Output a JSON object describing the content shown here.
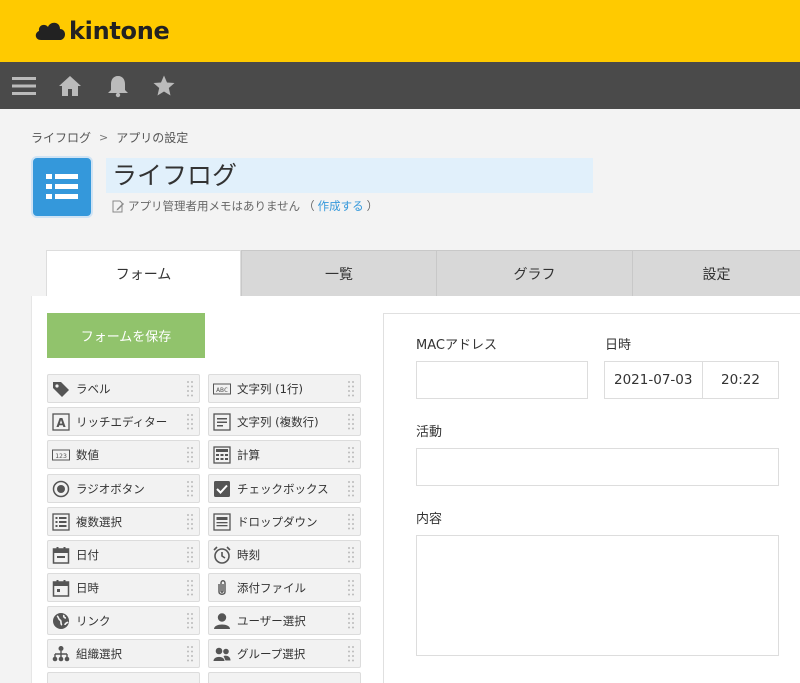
{
  "header": {
    "logo_text": "kintone",
    "brand_color": "#ffca00"
  },
  "nav": {
    "icons": [
      "menu-icon",
      "home-icon",
      "bell-icon",
      "star-icon"
    ]
  },
  "breadcrumb": {
    "app": "ライフログ",
    "separator": ">",
    "current": "アプリの設定"
  },
  "app": {
    "name": "ライフログ",
    "memo_text": "アプリ管理者用メモはありません",
    "memo_open": "（",
    "memo_link": "作成する",
    "memo_close": "）"
  },
  "tabs": [
    {
      "label": "フォーム",
      "active": true
    },
    {
      "label": "一覧",
      "active": false
    },
    {
      "label": "グラフ",
      "active": false
    },
    {
      "label": "設定",
      "active": false
    }
  ],
  "save_button": {
    "label": "フォームを保存",
    "color": "#91c36c"
  },
  "parts": [
    {
      "label": "ラベル",
      "icon": "tag-icon"
    },
    {
      "label": "文字列 (1行)",
      "icon": "abc-icon"
    },
    {
      "label": "リッチエディター",
      "icon": "rich-editor-icon"
    },
    {
      "label": "文字列 (複数行)",
      "icon": "multiline-text-icon"
    },
    {
      "label": "数値",
      "icon": "number-icon"
    },
    {
      "label": "計算",
      "icon": "calculator-icon"
    },
    {
      "label": "ラジオボタン",
      "icon": "radio-icon"
    },
    {
      "label": "チェックボックス",
      "icon": "checkbox-icon"
    },
    {
      "label": "複数選択",
      "icon": "multi-select-icon"
    },
    {
      "label": "ドロップダウン",
      "icon": "dropdown-icon"
    },
    {
      "label": "日付",
      "icon": "calendar-icon"
    },
    {
      "label": "時刻",
      "icon": "clock-icon"
    },
    {
      "label": "日時",
      "icon": "datetime-icon"
    },
    {
      "label": "添付ファイル",
      "icon": "paperclip-icon"
    },
    {
      "label": "リンク",
      "icon": "globe-icon"
    },
    {
      "label": "ユーザー選択",
      "icon": "user-icon"
    },
    {
      "label": "組織選択",
      "icon": "org-icon"
    },
    {
      "label": "グループ選択",
      "icon": "group-icon"
    }
  ],
  "form": {
    "fields": {
      "mac": {
        "label": "MACアドレス",
        "value": ""
      },
      "datetime": {
        "label": "日時",
        "date": "2021-07-03",
        "time": "20:22"
      },
      "activity": {
        "label": "活動",
        "value": ""
      },
      "content": {
        "label": "内容",
        "value": ""
      }
    }
  }
}
